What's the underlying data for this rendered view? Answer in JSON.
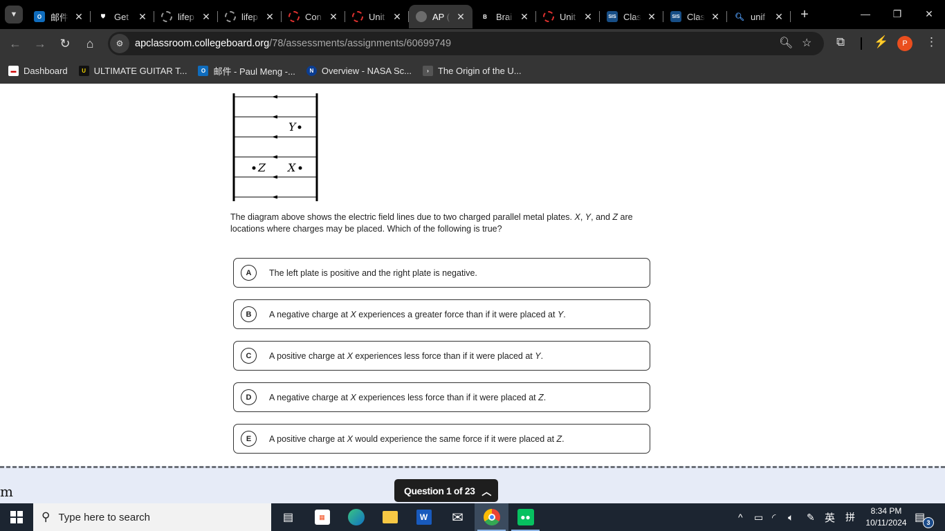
{
  "browser": {
    "tabs": [
      {
        "title": "邮件",
        "favicon": "outlook-icon",
        "active": false
      },
      {
        "title": "Get",
        "favicon": "acorn-icon",
        "active": false
      },
      {
        "title": "lifep",
        "favicon": "loading-ring-icon",
        "active": false
      },
      {
        "title": "lifep",
        "favicon": "loading-ring-icon",
        "active": false
      },
      {
        "title": "Con",
        "favicon": "red-ring-icon",
        "active": false
      },
      {
        "title": "Unit",
        "favicon": "red-ring-icon",
        "active": false
      },
      {
        "title": "AP (",
        "favicon": "globe-icon",
        "active": true
      },
      {
        "title": "Brai",
        "favicon": "brainly-icon",
        "active": false
      },
      {
        "title": "Unit",
        "favicon": "red-ring-icon",
        "active": false
      },
      {
        "title": "Clas",
        "favicon": "sis-icon",
        "active": false
      },
      {
        "title": "Clas",
        "favicon": "sis-icon",
        "active": false
      },
      {
        "title": "unif",
        "favicon": "search-icon",
        "active": false
      }
    ],
    "new_tab": "+",
    "url_host": "apclassroom.collegeboard.org",
    "url_path": "/78/assessments/assignments/60699749",
    "profile_initial": "P",
    "bookmarks": [
      {
        "label": "Dashboard",
        "icon": "dashboard-icon"
      },
      {
        "label": "ULTIMATE GUITAR T...",
        "icon": "ultimate-guitar-icon"
      },
      {
        "label": "邮件 - Paul Meng -...",
        "icon": "outlook-icon"
      },
      {
        "label": "Overview - NASA Sc...",
        "icon": "nasa-icon"
      },
      {
        "label": "The Origin of the U...",
        "icon": "bookmark-icon"
      }
    ]
  },
  "question": {
    "diagram": {
      "labels": {
        "Y": "Y",
        "Z": "Z",
        "X": "X"
      },
      "field_direction": "right-to-left",
      "field_line_count": 6
    },
    "stem_part1": "The diagram above shows the electric field lines due to two charged parallel metal plates. ",
    "stem_vars": [
      "X",
      "Y",
      "Z"
    ],
    "stem_part2": "are locations where charges may be placed. Which of the following is true?",
    "choices": [
      {
        "letter": "A",
        "parts": [
          "The left plate is positive and the right plate is negative."
        ]
      },
      {
        "letter": "B",
        "parts": [
          "A negative charge at ",
          "X",
          " experiences a greater force than if it were placed at ",
          "Y",
          "."
        ]
      },
      {
        "letter": "C",
        "parts": [
          "A positive charge at ",
          "X",
          " experiences less force than if it were placed at ",
          "Y",
          "."
        ]
      },
      {
        "letter": "D",
        "parts": [
          "A negative charge at ",
          "X",
          " experiences less force than if it were placed at ",
          "Z",
          "."
        ]
      },
      {
        "letter": "E",
        "parts": [
          "A positive charge at ",
          "X",
          " would experience the same force if it were placed at ",
          "Z",
          "."
        ]
      }
    ]
  },
  "footer": {
    "brand_fragment": "m",
    "question_nav": "Question 1 of 23"
  },
  "taskbar": {
    "search_placeholder": "Type here to search",
    "time": "8:34 PM",
    "date": "10/11/2024",
    "ime_lang": "英",
    "ime_mode": "拼",
    "notification_count": "3"
  }
}
